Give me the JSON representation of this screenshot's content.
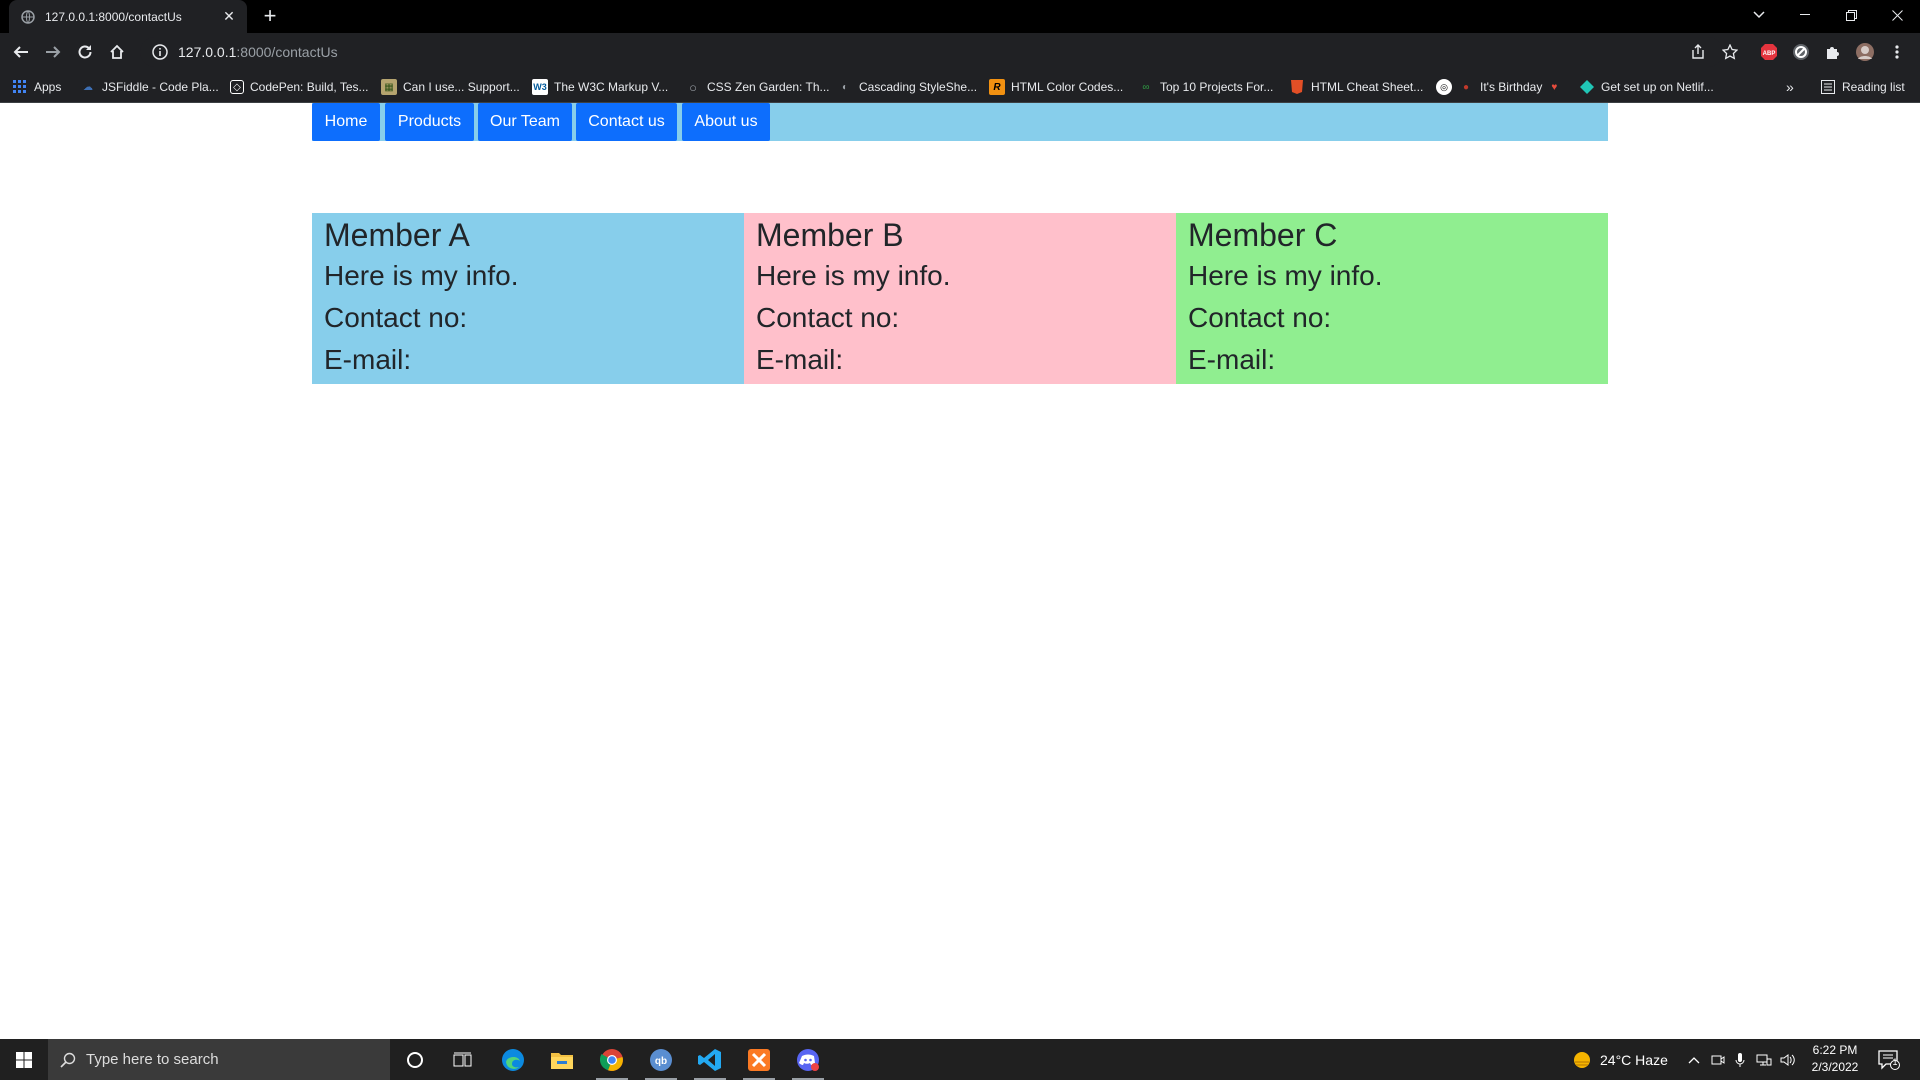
{
  "browser": {
    "tab_title": "127.0.0.1:8000/contactUs",
    "url_host": "127.0.0.1",
    "url_path": ":8000/contactUs",
    "bookmarks": [
      {
        "label": "Apps",
        "icon": "apps-grid-icon",
        "color": "#4285f4"
      },
      {
        "label": "JSFiddle - Code Pla...",
        "icon": "jsfiddle-icon",
        "color": "#3d6fb4"
      },
      {
        "label": "CodePen: Build, Tes...",
        "icon": "codepen-icon",
        "color": "#ffffff"
      },
      {
        "label": "Can I use... Support...",
        "icon": "caniuse-icon",
        "color": "#b5a46f"
      },
      {
        "label": "The W3C Markup V...",
        "icon": "w3c-icon",
        "color": "#005a9c"
      },
      {
        "label": "CSS Zen Garden: Th...",
        "icon": "zen-garden-icon",
        "color": "#9aa0a6"
      },
      {
        "label": "Cascading StyleShe...",
        "icon": "css-icon",
        "color": "#777777"
      },
      {
        "label": "HTML Color Codes...",
        "icon": "html-color-codes-icon",
        "color": "#f29111"
      },
      {
        "label": "Top 10 Projects For...",
        "icon": "projects-icon",
        "color": "#2f9e44"
      },
      {
        "label": "HTML Cheat Sheet...",
        "icon": "html5-icon",
        "color": "#e34f26"
      },
      {
        "label": "It's Birthday",
        "icon": "birthday-icon",
        "color": "#c0392b"
      },
      {
        "label": "Get set up on Netlif...",
        "icon": "netlify-icon",
        "color": "#20c6b6"
      }
    ],
    "reading_list": "Reading list"
  },
  "nav": {
    "items": [
      "Home",
      "Products",
      "Our Team",
      "Contact us",
      "About us"
    ],
    "bar_color": "#87ceeb",
    "button_color": "#0d6efd"
  },
  "members": [
    {
      "name": "Member A",
      "info": "Here is my info.",
      "contact": "Contact no:",
      "email": "E-mail:",
      "color": "#87ceeb"
    },
    {
      "name": "Member B",
      "info": "Here is my info.",
      "contact": "Contact no:",
      "email": "E-mail:",
      "color": "#ffc0cb"
    },
    {
      "name": "Member C",
      "info": "Here is my info.",
      "contact": "Contact no:",
      "email": "E-mail:",
      "color": "#90ee90"
    }
  ],
  "taskbar": {
    "search_placeholder": "Type here to search",
    "weather": "24°C  Haze",
    "time": "6:22 PM",
    "date": "2/3/2022",
    "notification_count": "1"
  }
}
